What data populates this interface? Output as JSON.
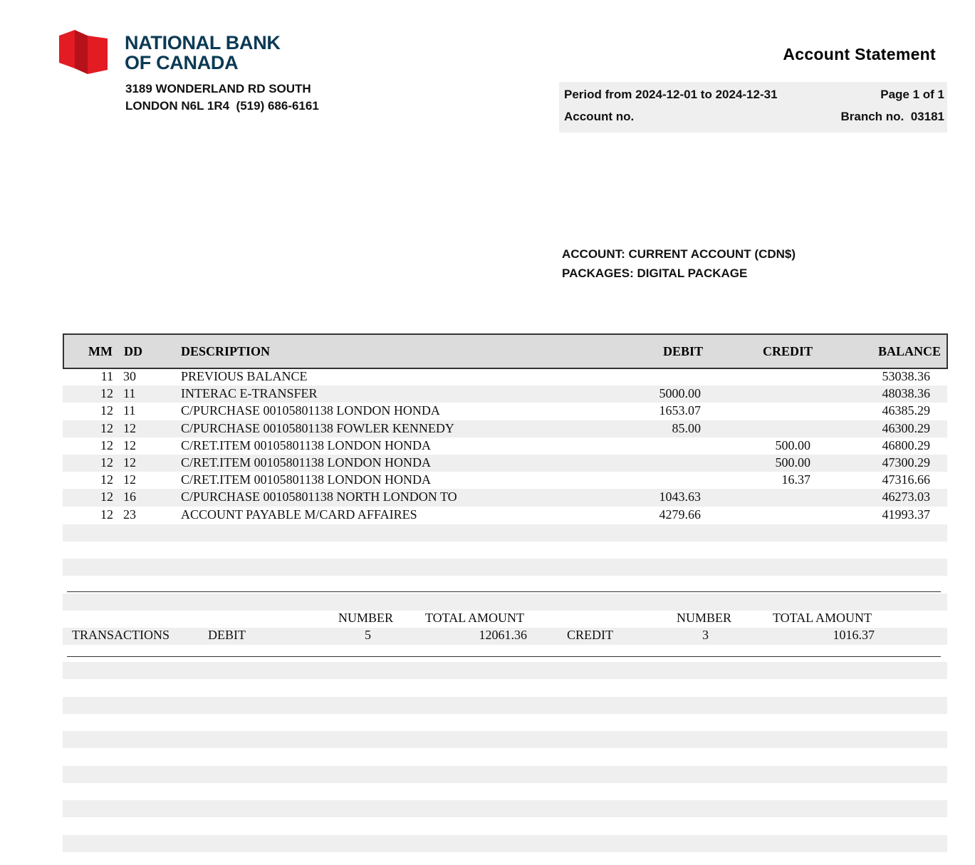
{
  "bank": {
    "name_line1": "NATIONAL BANK",
    "name_line2": "OF CANADA",
    "address_line1": "3189 WONDERLAND RD SOUTH",
    "address_line2": "LONDON N6L 1R4  (519) 686-6161",
    "brand_color": "#0b3a54",
    "logo_color": "#e31b23",
    "logo_icon": "national-bank-flag-logo"
  },
  "statement": {
    "title": "Account Statement",
    "period": "Period from 2024-12-01 to 2024-12-31",
    "page": "Page 1 of 1",
    "account_no_label": "Account no.",
    "branch_no": "Branch no.  03181"
  },
  "account": {
    "type": "ACCOUNT: CURRENT ACCOUNT (CDN$)",
    "packages": "PACKAGES: DIGITAL PACKAGE"
  },
  "table": {
    "headers": {
      "mm": "MM",
      "dd": "DD",
      "description": "DESCRIPTION",
      "debit": "DEBIT",
      "credit": "CREDIT",
      "balance": "BALANCE"
    },
    "rows": [
      {
        "mm": "11",
        "dd": "30",
        "description": "PREVIOUS BALANCE",
        "debit": "",
        "credit": "",
        "balance": "53038.36"
      },
      {
        "mm": "12",
        "dd": "11",
        "description": "INTERAC E-TRANSFER",
        "debit": "5000.00",
        "credit": "",
        "balance": "48038.36"
      },
      {
        "mm": "12",
        "dd": "11",
        "description": "C/PURCHASE 00105801138 LONDON HONDA",
        "debit": "1653.07",
        "credit": "",
        "balance": "46385.29"
      },
      {
        "mm": "12",
        "dd": "12",
        "description": "C/PURCHASE 00105801138 FOWLER KENNEDY",
        "debit": "85.00",
        "credit": "",
        "balance": "46300.29"
      },
      {
        "mm": "12",
        "dd": "12",
        "description": "C/RET.ITEM 00105801138 LONDON HONDA",
        "debit": "",
        "credit": "500.00",
        "balance": "46800.29"
      },
      {
        "mm": "12",
        "dd": "12",
        "description": "C/RET.ITEM 00105801138 LONDON HONDA",
        "debit": "",
        "credit": "500.00",
        "balance": "47300.29"
      },
      {
        "mm": "12",
        "dd": "12",
        "description": "C/RET.ITEM 00105801138 LONDON HONDA",
        "debit": "",
        "credit": "16.37",
        "balance": "47316.66"
      },
      {
        "mm": "12",
        "dd": "16",
        "description": "C/PURCHASE 00105801138 NORTH LONDON TO",
        "debit": "1043.63",
        "credit": "",
        "balance": "46273.03"
      },
      {
        "mm": "12",
        "dd": "23",
        "description": "ACCOUNT PAYABLE M/CARD AFFAIRES",
        "debit": "4279.66",
        "credit": "",
        "balance": "41993.37"
      }
    ]
  },
  "summary": {
    "transactions_label": "TRANSACTIONS",
    "debit_label": "DEBIT",
    "credit_label": "CREDIT",
    "number_header": "NUMBER",
    "total_amount_header": "TOTAL AMOUNT",
    "debit_number": "5",
    "debit_total": "12061.36",
    "credit_number": "3",
    "credit_total": "1016.37"
  }
}
